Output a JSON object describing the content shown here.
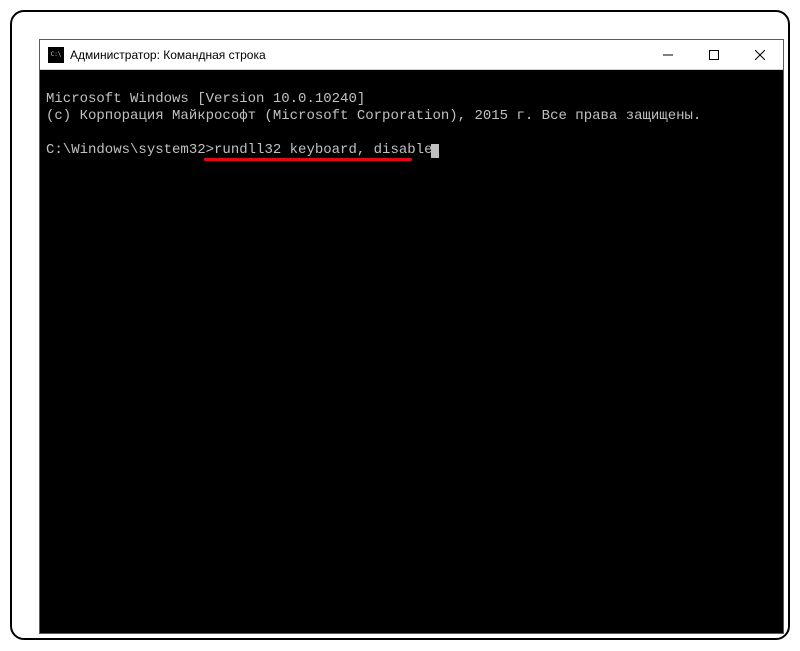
{
  "window": {
    "title": "Администратор: Командная строка"
  },
  "console": {
    "line1": "Microsoft Windows [Version 10.0.10240]",
    "line2": "(с) Корпорация Майкрософт (Microsoft Corporation), 2015 г. Все права защищены.",
    "blank": "",
    "prompt": "C:\\Windows\\system32>",
    "command": "rundll32 keyboard, disable"
  },
  "icons": {
    "minimize": "minimize",
    "maximize": "maximize",
    "close": "close"
  }
}
